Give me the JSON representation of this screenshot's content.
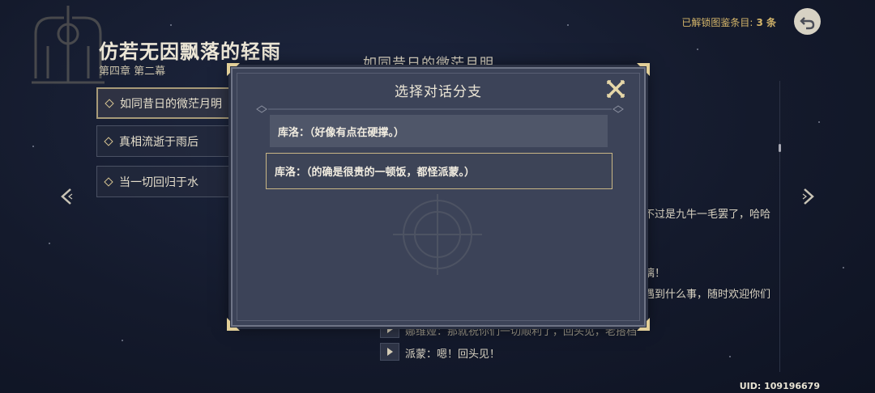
{
  "header": {
    "title": "仿若无因飘落的轻雨",
    "subtitle": "第四章 第二幕",
    "unlocked_label": "已解锁图鉴条目:",
    "unlocked_count": "3 条",
    "uid": "UID: 109196679"
  },
  "chapters": [
    {
      "label": "如同昔日的微茫月明",
      "active": true
    },
    {
      "label": "真相流逝于雨后",
      "active": false
    },
    {
      "label": "当一切回归于水",
      "active": false
    }
  ],
  "right_panel": {
    "title": "如同昔日的微茫月明",
    "partial_lines": [
      "不过是九牛一毛罢了，哈哈",
      "璃！",
      "遇到什么事，随时欢迎你们"
    ],
    "dialog_lines": [
      "娜维娅：那就祝你们一切顺利了，回头见，老搭档",
      "派蒙：嗯！回头见！"
    ]
  },
  "dialog": {
    "title": "选择对话分支",
    "options": [
      {
        "text": "库洛：（好像有点在硬撑。）",
        "selected": false
      },
      {
        "text": "库洛：（的确是很贵的一顿饭，都怪派蒙。）",
        "selected": true
      }
    ]
  },
  "colors": {
    "accent_gold": "#d4b56a",
    "dialog_bg": "#3c4358",
    "background": "#141a2c"
  },
  "icons": {
    "close": "close-x-icon",
    "back": "back-arrow-icon",
    "prev": "chevron-left-icon",
    "next": "chevron-right-icon",
    "play": "play-icon"
  }
}
